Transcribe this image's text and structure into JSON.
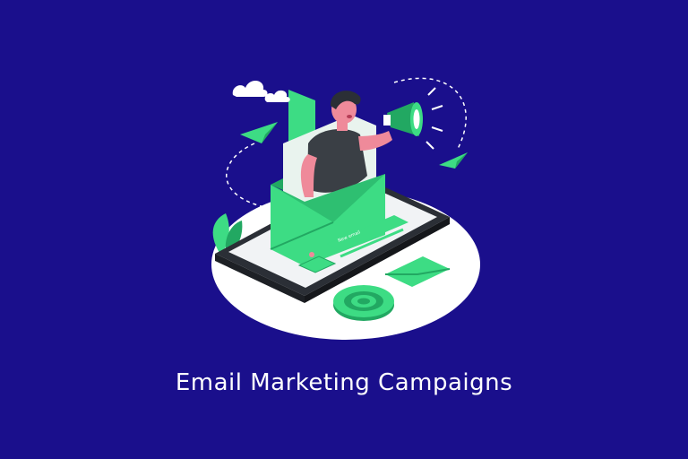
{
  "caption": "Email Marketing Campaigns",
  "screen_card_text": "New email",
  "colors": {
    "background": "#1a0f8c",
    "accent_green": "#3ddc84",
    "dark_green": "#22a862",
    "phone_dark": "#2b2f36",
    "platform": "#ffffff",
    "skin": "#ef8a9a",
    "shirt": "#3a3f45"
  },
  "icons": [
    "cloud-icon",
    "paper-plane-icon",
    "megaphone-icon",
    "envelope-icon",
    "at-sign-icon",
    "plant-icon"
  ]
}
